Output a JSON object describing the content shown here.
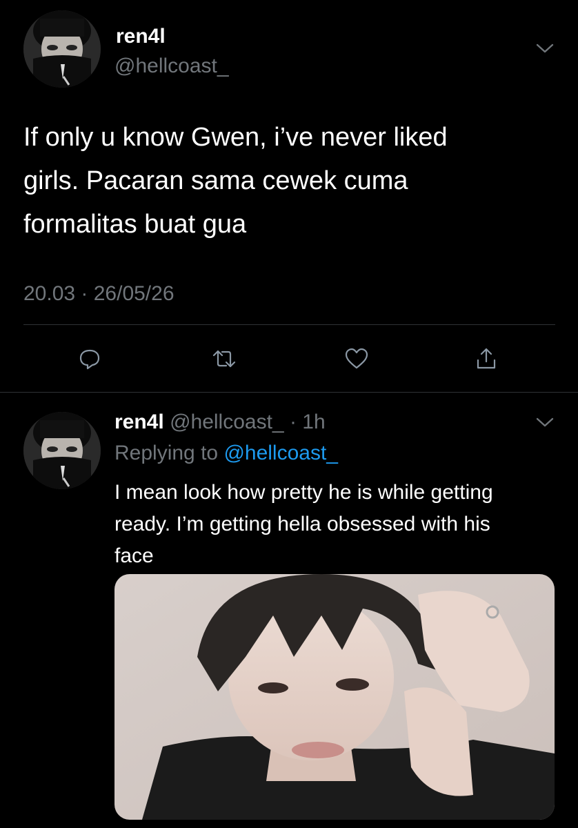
{
  "main_tweet": {
    "display_name": "ren4l",
    "handle": "@hellcoast_",
    "text_lines": [
      "If only u know Gwen, i’ve never liked",
      "girls. Pacaran sama cewek cuma",
      "formalitas buat gua"
    ],
    "timestamp": "20.03 · 26/05/26"
  },
  "actions": {
    "reply_icon": "speech-bubble-icon",
    "retweet_icon": "retweet-icon",
    "like_icon": "heart-icon",
    "share_icon": "share-icon"
  },
  "reply_tweet": {
    "display_name": "ren4l",
    "handle_time": "@hellcoast_ · 1h",
    "replying_prefix": "Replying to",
    "replying_to": "@hellcoast_",
    "text_lines": [
      "I mean look how pretty he is while getting",
      "ready. I’m getting hella obsessed with his",
      "face"
    ]
  },
  "colors": {
    "background": "#000000",
    "text": "#ffffff",
    "muted": "#71767b",
    "link": "#1d9bf0",
    "divider": "#2f3336"
  }
}
